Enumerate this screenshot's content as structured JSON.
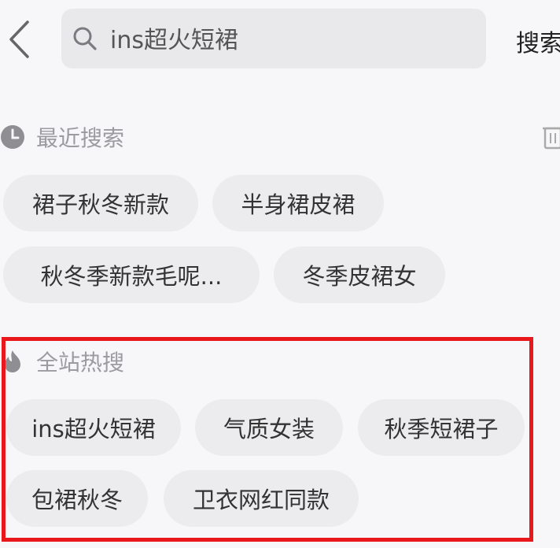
{
  "search": {
    "value": "ins超火短裙",
    "button_label": "搜索"
  },
  "recent": {
    "title": "最近搜索",
    "items": [
      "裙子秋冬新款",
      "半身裙皮裙",
      "秋冬季新款毛呢...",
      "冬季皮裙女"
    ]
  },
  "hot": {
    "title": "全站热搜",
    "items": [
      "ins超火短裙",
      "气质女装",
      "秋季短裙子",
      "包裙秋冬",
      "卫衣网红同款"
    ]
  },
  "colors": {
    "highlight": "#e8181c",
    "chip_bg": "#ececef",
    "search_bg": "#e9e9ec"
  },
  "icons": {
    "back": "chevron-left-icon",
    "search": "magnifier-icon",
    "recent": "clock-icon",
    "hot": "flame-icon",
    "clear": "trash-icon"
  }
}
